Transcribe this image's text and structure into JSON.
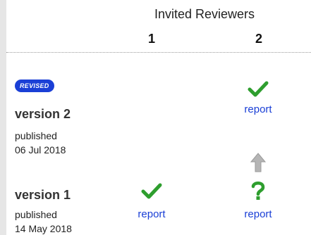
{
  "header": {
    "title": "Invited Reviewers",
    "columns": [
      "1",
      "2"
    ]
  },
  "versions": [
    {
      "badge": "REVISED",
      "title": "version 2",
      "published_label": "published",
      "date": "06 Jul 2018",
      "reviews": [
        null,
        {
          "status": "approved",
          "icon": "check-icon",
          "link": "report"
        }
      ]
    },
    {
      "title": "version 1",
      "published_label": "published",
      "date": "14 May 2018",
      "reviews": [
        {
          "status": "approved",
          "icon": "check-icon",
          "link": "report"
        },
        {
          "status": "approved-with-reservations",
          "icon": "question-icon",
          "link": "report"
        }
      ]
    }
  ],
  "colors": {
    "approved": "#2e9e2e",
    "reservations": "#2e9e2e",
    "link": "#1a3fd6",
    "badge_bg": "#1a3fd6",
    "arrow": "#b5b5b5"
  },
  "icons": {
    "arrow_up": "arrow-up-icon"
  }
}
